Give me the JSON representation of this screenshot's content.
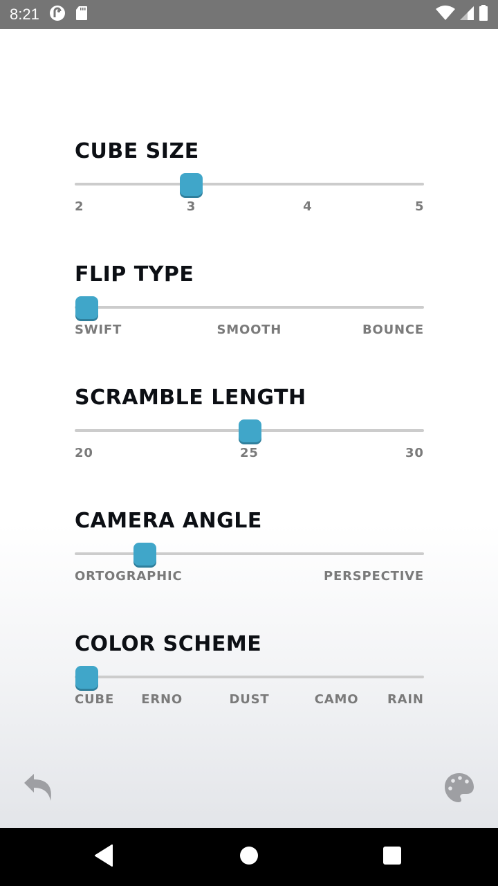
{
  "status_bar": {
    "time": "8:21",
    "left_icons": [
      "pocket-casts-icon",
      "sd-card-icon"
    ],
    "right_icons": [
      "wifi-icon",
      "cellular-signal-icon",
      "battery-icon"
    ]
  },
  "settings": [
    {
      "id": "cube-size",
      "title": "CUBE SIZE",
      "ticks": [
        "2",
        "3",
        "4",
        "5"
      ],
      "selected_index": 1,
      "selected_value": "3"
    },
    {
      "id": "flip-type",
      "title": "FLIP TYPE",
      "ticks": [
        "SWIFT",
        "SMOOTH",
        "BOUNCE"
      ],
      "selected_index": 0,
      "selected_value": "SWIFT"
    },
    {
      "id": "scramble-length",
      "title": "SCRAMBLE LENGTH",
      "ticks": [
        "20",
        "25",
        "30"
      ],
      "range": [
        20,
        30
      ],
      "selected_value": 25
    },
    {
      "id": "camera-angle",
      "title": "CAMERA ANGLE",
      "ticks": [
        "ORTOGRAPHIC",
        "PERSPECTIVE"
      ],
      "selected_fraction": 0.2
    },
    {
      "id": "color-scheme",
      "title": "COLOR SCHEME",
      "ticks": [
        "CUBE",
        "ERNO",
        "DUST",
        "CAMO",
        "RAIN"
      ],
      "selected_index": 0,
      "selected_value": "CUBE"
    }
  ],
  "bottom_actions": {
    "left": "undo-back-icon",
    "right": "palette-icon"
  },
  "nav_bar": {
    "buttons": [
      "back",
      "home",
      "recents"
    ]
  },
  "colors": {
    "accent": "#40a6c9",
    "title": "#0c0f14",
    "tick_label": "#7a7a7a",
    "track": "#cccccc",
    "icon_gray": "#9e9fa3"
  }
}
